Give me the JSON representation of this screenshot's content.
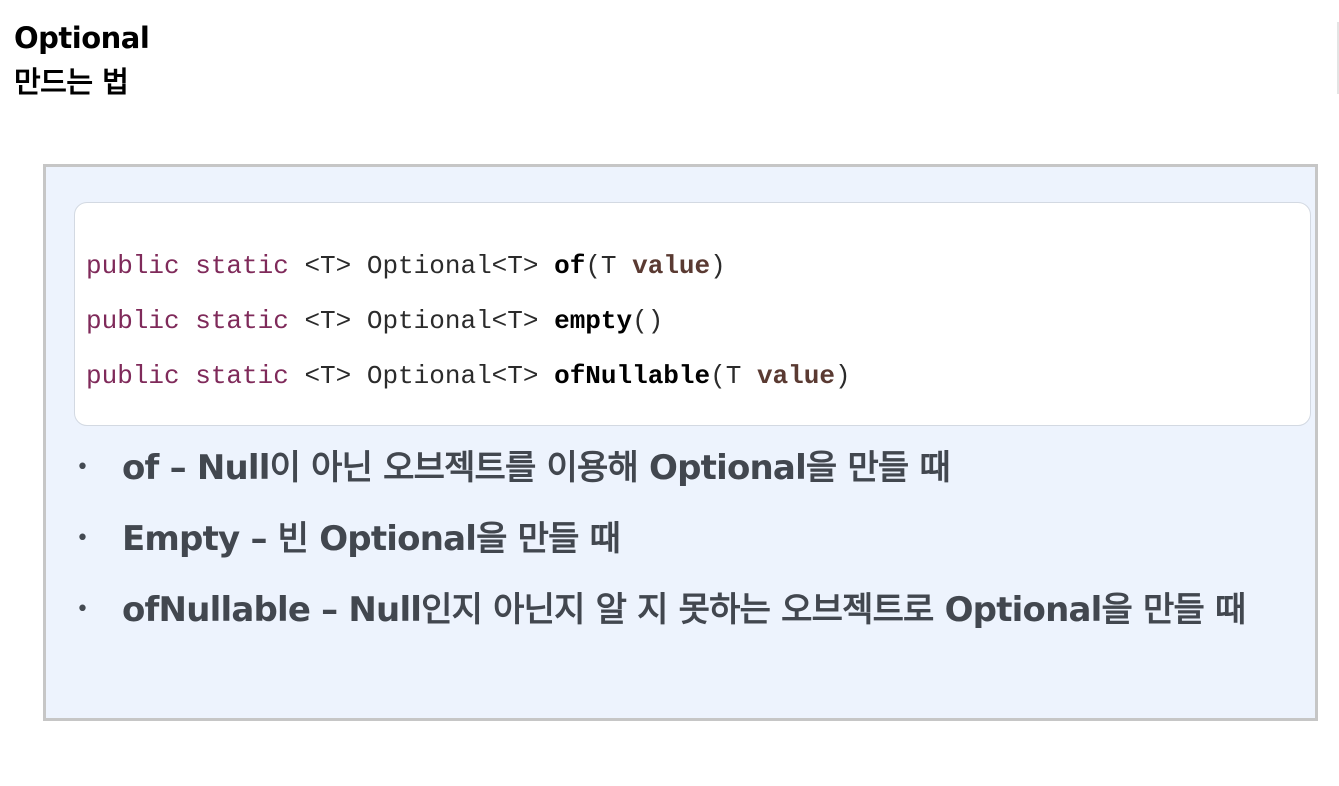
{
  "page": {
    "title_line1": "Optional",
    "title_line2": "만드는 법"
  },
  "code": {
    "lines": [
      {
        "modifiers": "public static",
        "generic": " <T> Optional<T> ",
        "method": "of",
        "open": "(T ",
        "param": "value",
        "close": ")"
      },
      {
        "modifiers": "public static",
        "generic": " <T> Optional<T> ",
        "method": "empty",
        "open": "()",
        "param": "",
        "close": ""
      },
      {
        "modifiers": "public static",
        "generic": " <T> Optional<T> ",
        "method": "ofNullable",
        "open": "(T ",
        "param": "value",
        "close": ")"
      }
    ]
  },
  "bullets": [
    {
      "marker": "•",
      "text": "of – Null이 아닌 오브젝트를 이용해 Optional을 만들 때"
    },
    {
      "marker": "•",
      "text": "Empty – 빈 Optional을 만들 때"
    },
    {
      "marker": "•",
      "text": "ofNullable – Null인지 아닌지 알 지 못하는 오브젝트로 Optional을 만들 때"
    }
  ],
  "colors": {
    "panel_background": "#edf3fd",
    "panel_border": "#c6c6c6",
    "code_keyword": "#7f2a5a",
    "code_param": "#5a3a32",
    "bullet_text": "#42474f"
  }
}
